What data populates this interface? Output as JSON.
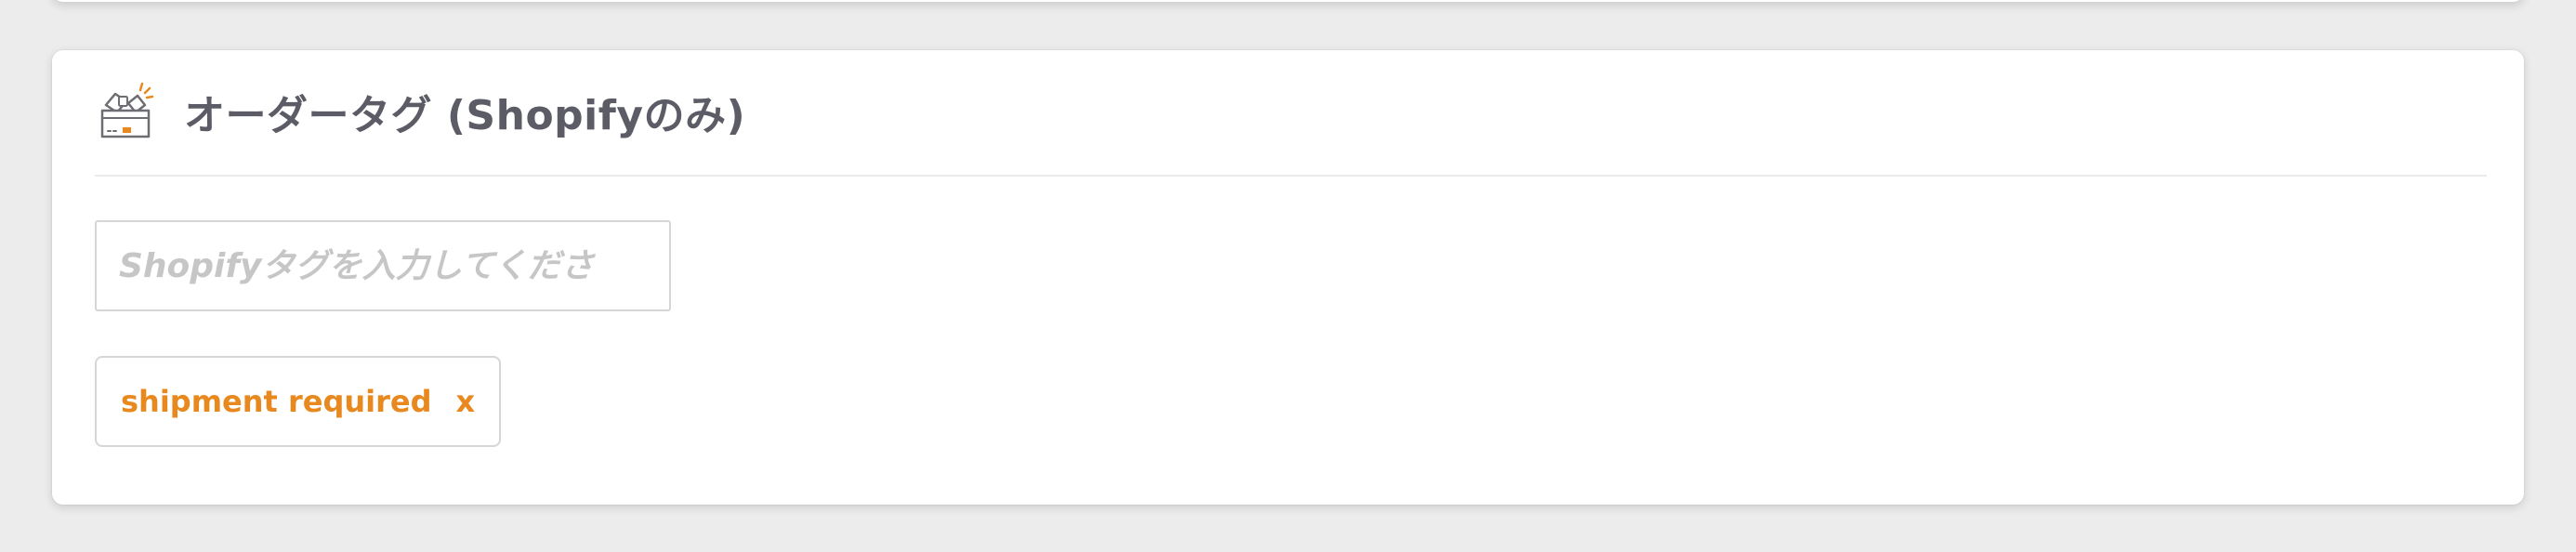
{
  "card": {
    "title": "オーダータグ (Shopifyのみ)",
    "icon": "open-box-icon"
  },
  "tag_input": {
    "value": "",
    "placeholder": "Shopifyタグを入力してくださ"
  },
  "tags": [
    {
      "label": "shipment required",
      "remove_label": "x"
    }
  ],
  "colors": {
    "accent": "#e8891f",
    "title": "#5c5c66",
    "placeholder": "#c6c6c6",
    "border": "#d6d6d6",
    "background": "#ececec",
    "card": "#ffffff"
  }
}
